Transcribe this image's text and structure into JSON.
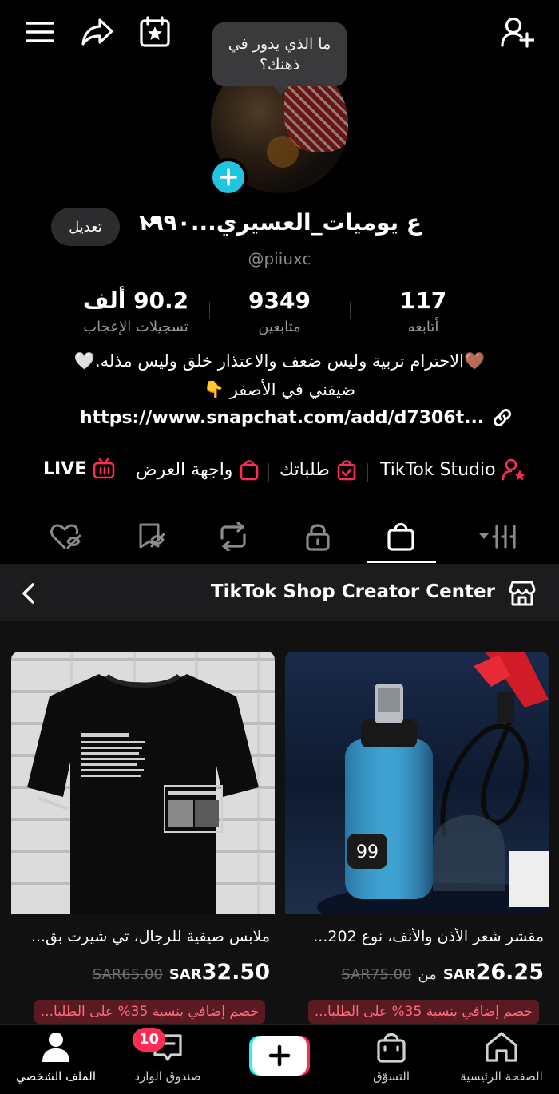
{
  "header": {
    "menu_icon": "hamburger-menu-icon",
    "share_icon": "share-arrow-icon",
    "calendar_icon": "calendar-star-icon",
    "add_friend_icon": "add-user-icon"
  },
  "profile": {
    "thought_bubble": "ما الذي يدور في ذهنك؟",
    "name": "ع يوميات_العسيري...١٩٩٠",
    "handle": "@piiuxc",
    "edit_label": "تعديل",
    "stats": [
      {
        "value": "117",
        "label": "أتابعه"
      },
      {
        "value": "9349",
        "label": "متابعين"
      },
      {
        "value": "90.2 ألف",
        "label": "تسجيلات الإعجاب"
      }
    ],
    "bio_line1": "🤎الاحترام تربية وليس ضعف والاعتذار خلق وليس مذله.🤍",
    "bio_line2": "ضيفني في الأصفر 👇",
    "link": "https://www.snapchat.com/add/d7306t..."
  },
  "tools": {
    "studio": "TikTok Studio",
    "orders": "طلباتك",
    "showcase": "واجهة العرض",
    "live": "LIVE"
  },
  "tabs": [
    "videos-grid",
    "shop",
    "private",
    "reposts",
    "favorites",
    "liked"
  ],
  "shop": {
    "header_title": "TikTok Shop Creator Center",
    "products": [
      {
        "title": "مقشر شعر الأذن والأنف، نوع 202...",
        "price_prefix": "من",
        "currency": "SAR",
        "price": "26.25",
        "old_price": "SAR75.00",
        "promo": "خصم إضافي بنسبة 35% على الطلبا..."
      },
      {
        "title": "ملابس صيفية للرجال، تي شيرت بق...",
        "price_prefix": "",
        "currency": "SAR",
        "price": "32.50",
        "old_price": "SAR65.00",
        "promo": "خصم إضافي بنسبة 35% على الطلبا..."
      }
    ]
  },
  "bottom_nav": {
    "home": "الصفحة الرئيسية",
    "shop": "التسوّق",
    "inbox": "صندوق الوارد",
    "inbox_badge": "10",
    "profile": "الملف الشخصي"
  },
  "colors": {
    "accent_red": "#fe2c55",
    "accent_cyan": "#20c5e0",
    "background": "#000000"
  }
}
